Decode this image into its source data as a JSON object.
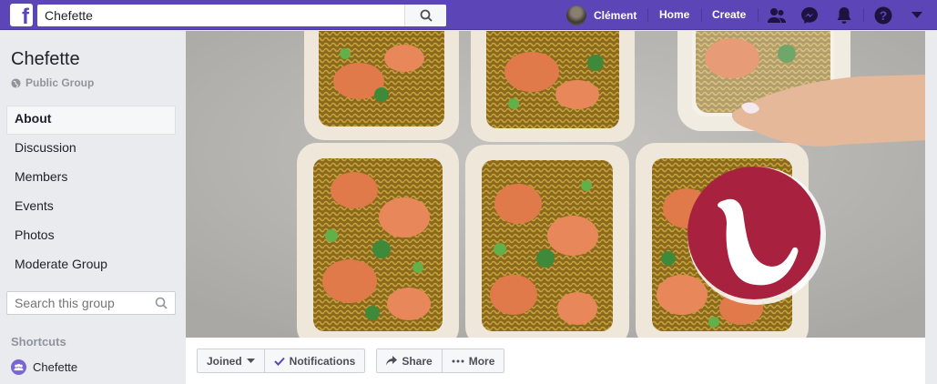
{
  "topbar": {
    "search_value": "Chefette",
    "user_name": "Clément",
    "home_label": "Home",
    "create_label": "Create",
    "colors": {
      "bar": "#5b45b7"
    }
  },
  "sidebar": {
    "group_name": "Chefette",
    "group_type": "Public Group",
    "items": [
      {
        "label": "About",
        "active": true
      },
      {
        "label": "Discussion"
      },
      {
        "label": "Members"
      },
      {
        "label": "Events"
      },
      {
        "label": "Photos"
      },
      {
        "label": "Moderate Group"
      }
    ],
    "search_placeholder": "Search this group",
    "shortcuts_title": "Shortcuts",
    "shortcut_label": "Chefette"
  },
  "actions": {
    "joined_label": "Joined",
    "notifications_label": "Notifications",
    "share_label": "Share",
    "more_label": "More"
  },
  "cover": {
    "logo_color": "#a8223f"
  }
}
